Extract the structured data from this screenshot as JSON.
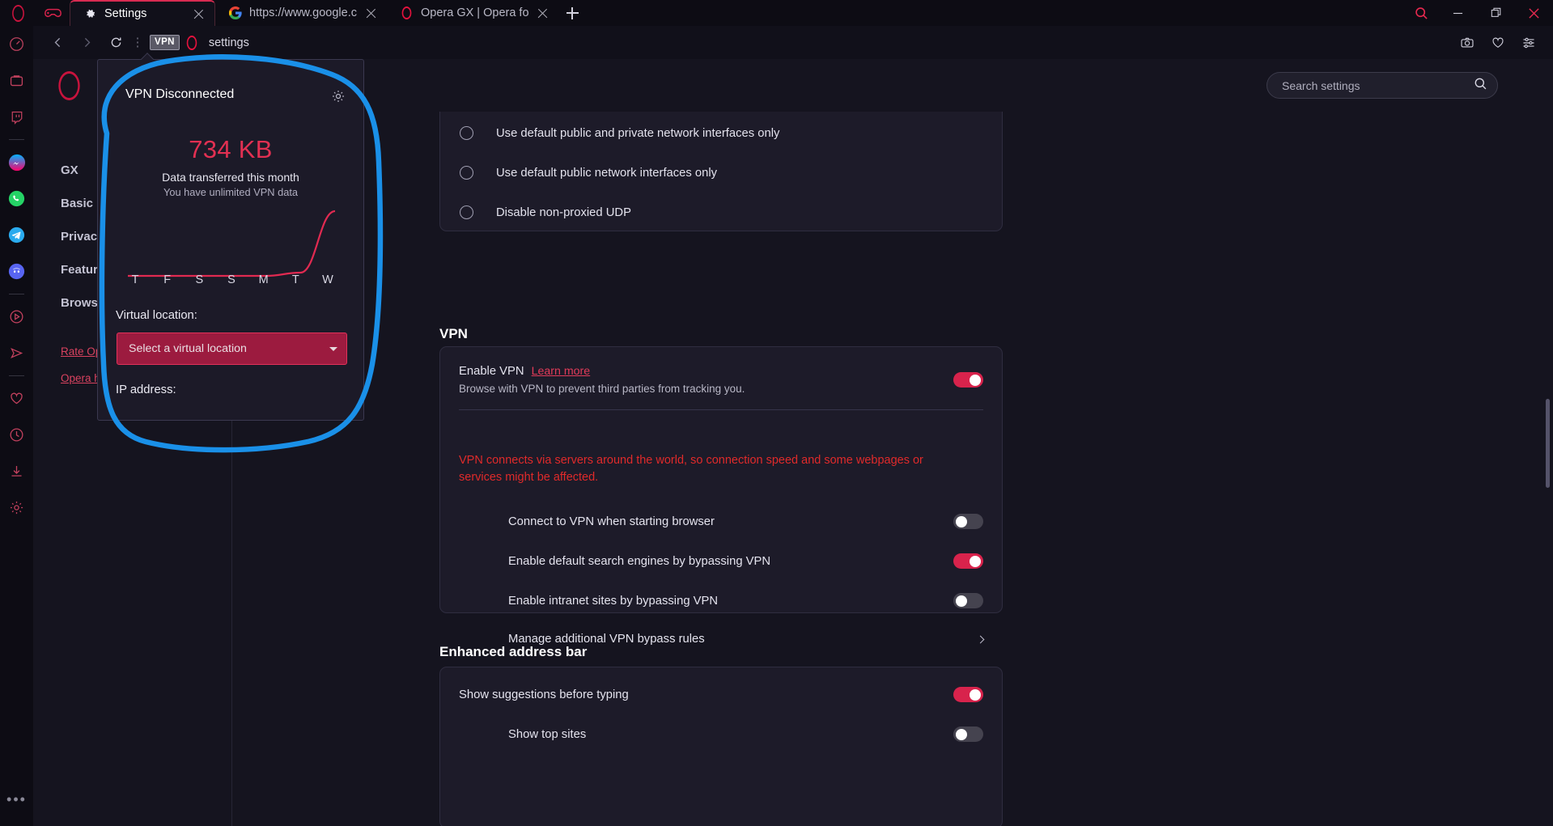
{
  "window": {
    "titlebar": {
      "opera_logo": "opera-logo",
      "gx_corner": "gx-gamepad-icon",
      "tabs": [
        {
          "id": "tab-settings",
          "icon": "gear-icon",
          "title": "Settings",
          "active": true,
          "closable": true
        },
        {
          "id": "tab-google",
          "icon": "google-icon",
          "title": "https://www.google.com/se",
          "active": false,
          "closable": true
        },
        {
          "id": "tab-opera-forums",
          "icon": "opera-icon",
          "title": "Opera GX | Opera forums",
          "active": false,
          "closable": true
        }
      ],
      "new_tab_label": "+",
      "right_icons": [
        "search-icon"
      ],
      "window_controls": [
        "minimize",
        "restore",
        "close"
      ]
    },
    "toolbar": {
      "back": "back-arrow-icon",
      "forward": "forward-arrow-icon",
      "reload": "reload-icon",
      "kebab": "more-options-icon",
      "vpn_badge": "VPN",
      "site_icon": "opera-icon",
      "address_text": "settings",
      "right_icons": [
        "camera-icon",
        "heart-icon",
        "easy-setup-icon"
      ]
    },
    "left_rail": {
      "icons": [
        "speed-dial-icon",
        "messenger-toolbox-icon",
        "twitch-icon",
        "facebook-messenger-icon",
        "whatsapp-icon",
        "telegram-icon",
        "discord-icon",
        "player-icon",
        "send-icon",
        "favorites-icon",
        "history-icon",
        "downloads-icon",
        "settings-gear-icon"
      ],
      "overflow": "•••"
    }
  },
  "settings_page": {
    "header": {
      "logo": "opera-logo",
      "search": {
        "placeholder": "Search settings",
        "value": "",
        "icon": "search-icon"
      }
    },
    "sidebar": {
      "items": [
        {
          "id": "sidebar-item-gx",
          "label": "GX"
        },
        {
          "id": "sidebar-item-basic",
          "label": "Basic"
        },
        {
          "id": "sidebar-item-privacy",
          "label": "Privacy & security"
        },
        {
          "id": "sidebar-item-features",
          "label": "Features"
        },
        {
          "id": "sidebar-item-browser",
          "label": "Browser"
        }
      ],
      "links": [
        {
          "id": "link-rate-opera",
          "label": "Rate Opera"
        },
        {
          "id": "link-opera-help",
          "label": "Opera help"
        }
      ]
    },
    "webrtc": {
      "options": [
        {
          "id": "radio-default-public-private",
          "label": "Use default public and private network interfaces only",
          "selected": false
        },
        {
          "id": "radio-default-public",
          "label": "Use default public network interfaces only",
          "selected": false
        },
        {
          "id": "radio-disable-udp",
          "label": "Disable non-proxied UDP",
          "selected": false
        }
      ]
    },
    "vpn_section": {
      "title": "VPN",
      "enable": {
        "label": "Enable VPN",
        "learn_more": "Learn more",
        "description": "Browse with VPN to prevent third parties from tracking you.",
        "toggle": "on"
      },
      "warning": "VPN connects via servers around the world, so connection speed and some webpages or services might be affected.",
      "sub_options": [
        {
          "id": "toggle-connect-on-start",
          "label": "Connect to VPN when starting browser",
          "toggle": "off"
        },
        {
          "id": "toggle-bypass-search",
          "label": "Enable default search engines by bypassing VPN",
          "toggle": "on"
        },
        {
          "id": "toggle-bypass-intranet",
          "label": "Enable intranet sites by bypassing VPN",
          "toggle": "off"
        }
      ],
      "manage_rules": {
        "label": "Manage additional VPN bypass rules",
        "chevron": "chevron-right-icon"
      }
    },
    "address_bar_section": {
      "title": "Enhanced address bar",
      "rows": [
        {
          "id": "toggle-show-suggestions",
          "label": "Show suggestions before typing",
          "toggle": "on"
        },
        {
          "id": "toggle-show-top-sites",
          "label": "Show top sites",
          "toggle": "off"
        }
      ]
    }
  },
  "vpn_popup": {
    "status": "VPN Disconnected",
    "settings_icon": "gear-icon",
    "amount": "734 KB",
    "caption": "Data transferred this month",
    "subcaption": "You have unlimited VPN data",
    "virtual_location_label": "Virtual location:",
    "location_value": "Select a virtual location",
    "location_caret": "chevron-down-icon",
    "ip_label": "IP address:",
    "chart_data": {
      "type": "line",
      "title": "Data transferred this month",
      "categories": [
        "T",
        "F",
        "S",
        "S",
        "M",
        "T",
        "W"
      ],
      "values": [
        0,
        0,
        0,
        0,
        0,
        0.05,
        1.0
      ],
      "ylabel": "",
      "xlabel": "",
      "ylim": [
        0,
        1
      ],
      "grid": false,
      "legend": false,
      "line_color": "#e12a51"
    }
  },
  "annotation": {
    "shape": "hand-drawn-circle",
    "color": "#1a90e8",
    "target": "vpn-popup"
  },
  "colors": {
    "accent": "#d8234c",
    "warning": "#e02a2a",
    "link": "#e23b59",
    "page_bg": "#15141f",
    "card_bg": "#1d1b29",
    "chrome_bg": "#0d0c14"
  }
}
